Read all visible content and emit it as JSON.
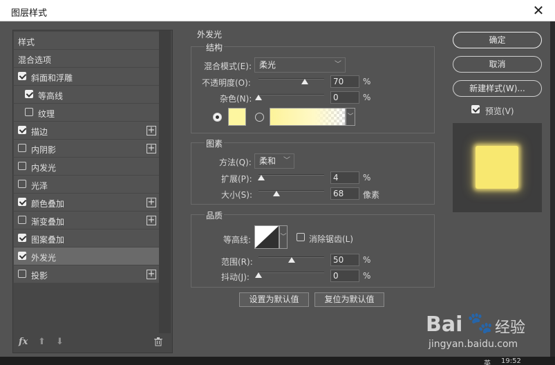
{
  "window": {
    "title": "图层样式",
    "close_glyph": "✕"
  },
  "left_panel": {
    "items": [
      {
        "label": "样式",
        "checkbox": null,
        "plus": false,
        "indent": 0
      },
      {
        "label": "混合选项",
        "checkbox": null,
        "plus": false,
        "indent": 0
      },
      {
        "label": "斜面和浮雕",
        "checkbox": true,
        "plus": false,
        "indent": 0
      },
      {
        "label": "等高线",
        "checkbox": true,
        "plus": false,
        "indent": 1
      },
      {
        "label": "纹理",
        "checkbox": false,
        "plus": false,
        "indent": 1
      },
      {
        "label": "描边",
        "checkbox": true,
        "plus": true,
        "indent": 0
      },
      {
        "label": "内阴影",
        "checkbox": false,
        "plus": true,
        "indent": 0
      },
      {
        "label": "内发光",
        "checkbox": false,
        "plus": false,
        "indent": 0
      },
      {
        "label": "光泽",
        "checkbox": false,
        "plus": false,
        "indent": 0
      },
      {
        "label": "颜色叠加",
        "checkbox": true,
        "plus": true,
        "indent": 0
      },
      {
        "label": "渐变叠加",
        "checkbox": false,
        "plus": true,
        "indent": 0
      },
      {
        "label": "图案叠加",
        "checkbox": true,
        "plus": false,
        "indent": 0
      },
      {
        "label": "外发光",
        "checkbox": true,
        "plus": false,
        "indent": 0,
        "selected": true
      },
      {
        "label": "投影",
        "checkbox": false,
        "plus": true,
        "indent": 0
      }
    ],
    "bottom_icons": [
      "fx-icon",
      "arrow-up-icon",
      "arrow-down-icon",
      "trash-icon"
    ],
    "fx_label": "fx"
  },
  "panel_title": "外发光",
  "structure": {
    "title": "结构",
    "blend_mode_label": "混合模式(E):",
    "blend_mode_value": "柔光",
    "opacity_label": "不透明度(O):",
    "opacity_value": "70",
    "opacity_unit": "%",
    "opacity": 70,
    "noise_label": "杂色(N):",
    "noise_value": "0",
    "noise_unit": "%",
    "noise": 0,
    "glow_color": "#fdf6a0",
    "gradient_colors": [
      "#fdf39a",
      "#fff9c8"
    ]
  },
  "elements": {
    "title": "图素",
    "technique_label": "方法(Q):",
    "technique_value": "柔和",
    "spread_label": "扩展(P):",
    "spread_value": "4",
    "spread_unit": "%",
    "spread": 4,
    "size_label": "大小(S):",
    "size_value": "68",
    "size_unit": "像素",
    "size": 68
  },
  "quality": {
    "title": "品质",
    "contour_label": "等高线:",
    "antialias_label": "消除锯齿(L)",
    "antialias": false,
    "range_label": "范围(R):",
    "range_value": "50",
    "range_unit": "%",
    "range": 50,
    "jitter_label": "抖动(J):",
    "jitter_value": "0",
    "jitter_unit": "%",
    "jitter": 0
  },
  "buttons": {
    "set_default": "设置为默认值",
    "reset_default": "复位为默认值",
    "ok": "确定",
    "cancel": "取消",
    "new_style": "新建样式(W)...",
    "preview_label": "预览(V)",
    "preview_checked": true
  },
  "watermark": {
    "brand": "Bai",
    "brand_suffix": "经验",
    "url": "jingyan.baidu.com"
  },
  "taskbar": {
    "clock": "19:52",
    "ime": "英"
  }
}
